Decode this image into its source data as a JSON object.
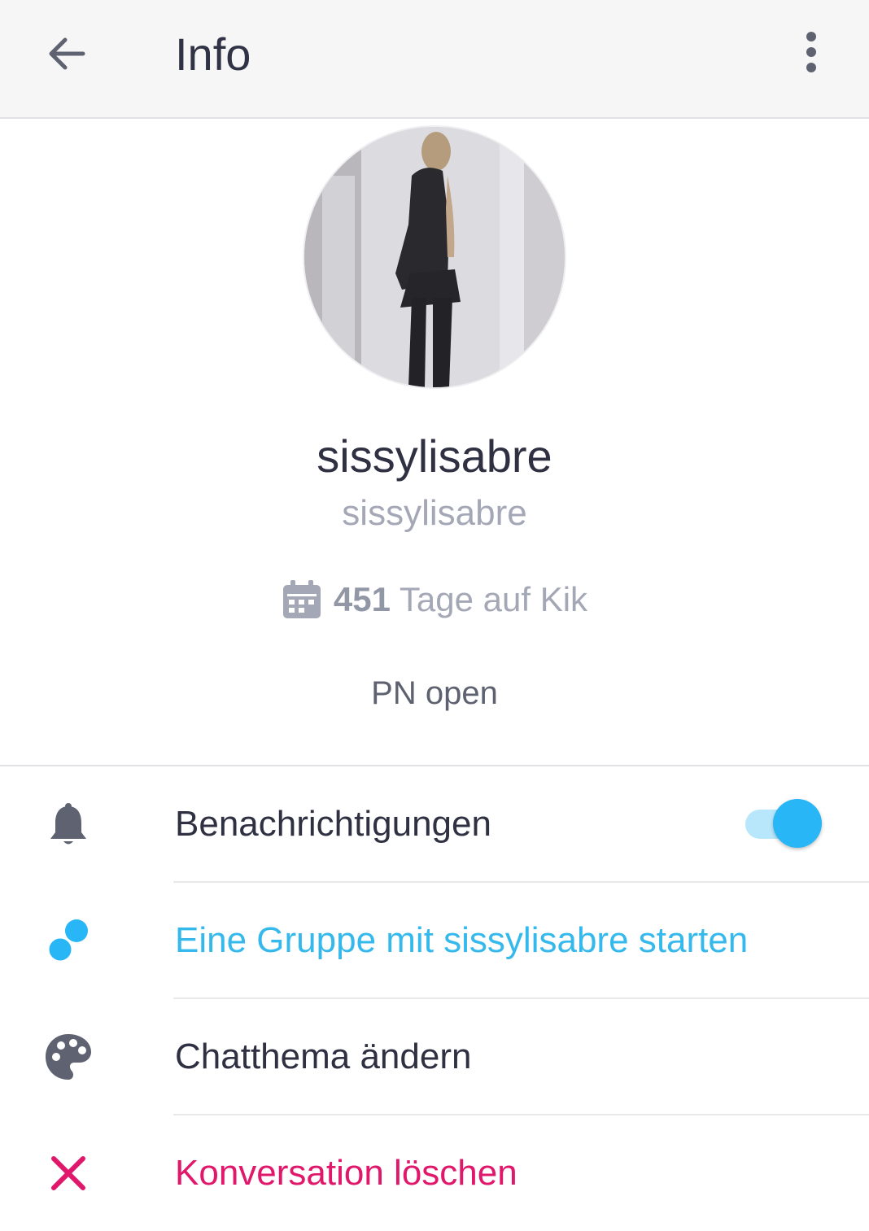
{
  "header": {
    "title": "Info",
    "back_icon": "arrow-left-icon",
    "menu_icon": "more-vertical-icon"
  },
  "profile": {
    "avatar_description": "profile photo",
    "display_name": "sissylisabre",
    "username": "sissylisabre",
    "days_count": "451",
    "days_suffix": " Tage auf Kik",
    "bio": "PN open"
  },
  "settings": {
    "notifications": {
      "label": "Benachrichtigungen",
      "enabled": true,
      "icon": "bell-icon"
    },
    "start_group": {
      "label": "Eine Gruppe mit sissylisabre starten",
      "icon": "group-icon"
    },
    "chat_theme": {
      "label": "Chatthema ändern",
      "icon": "palette-icon"
    },
    "delete_conversation": {
      "label": "Konversation löschen",
      "icon": "close-icon"
    }
  },
  "colors": {
    "accent": "#29b6f6",
    "link_blue": "#35b9ec",
    "destructive": "#e0176a",
    "muted_text": "#a4a8b6",
    "icon_gray": "#5f6270"
  }
}
